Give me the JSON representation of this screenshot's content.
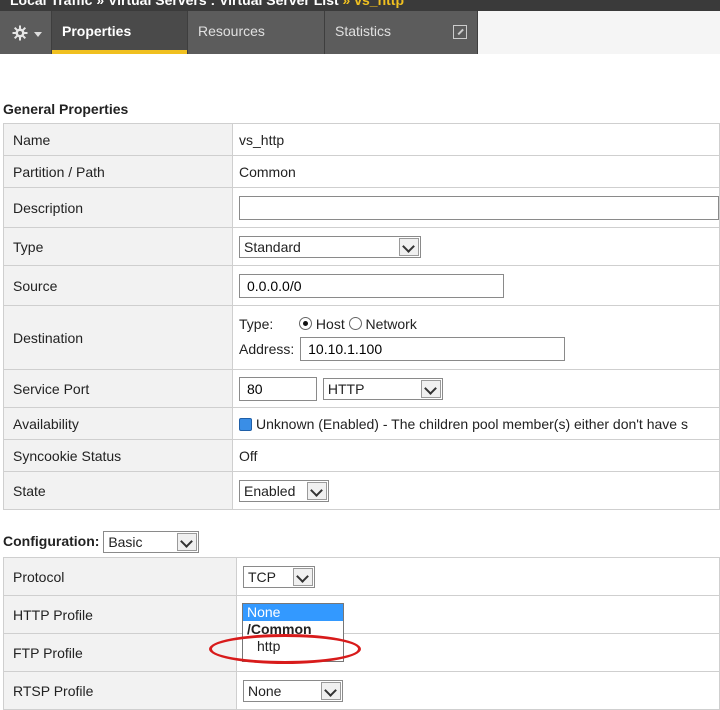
{
  "breadcrumb": {
    "part1": "Local Traffic",
    "sep": "»",
    "part2": "Virtual Servers : Virtual Server List",
    "current": "vs_http"
  },
  "tabs": [
    {
      "label": "Properties",
      "active": true
    },
    {
      "label": "Resources",
      "active": false
    },
    {
      "label": "Statistics",
      "active": false
    }
  ],
  "general": {
    "title": "General Properties",
    "name": {
      "label": "Name",
      "value": "vs_http"
    },
    "partition": {
      "label": "Partition / Path",
      "value": "Common"
    },
    "description": {
      "label": "Description",
      "value": ""
    },
    "type": {
      "label": "Type",
      "value": "Standard"
    },
    "source": {
      "label": "Source",
      "value": "0.0.0.0/0"
    },
    "destination": {
      "label": "Destination",
      "type_label": "Type:",
      "host_label": "Host",
      "network_label": "Network",
      "address_label": "Address:",
      "address": "10.10.1.100"
    },
    "service_port": {
      "label": "Service Port",
      "port": "80",
      "protocol": "HTTP"
    },
    "availability": {
      "label": "Availability",
      "value": "Unknown (Enabled) - The children pool member(s) either don't have s"
    },
    "syncookie": {
      "label": "Syncookie Status",
      "value": "Off"
    },
    "state": {
      "label": "State",
      "value": "Enabled"
    }
  },
  "configuration": {
    "title": "Configuration:",
    "mode": "Basic",
    "protocol": {
      "label": "Protocol",
      "value": "TCP"
    },
    "http_profile": {
      "label": "HTTP Profile"
    },
    "ftp_profile": {
      "label": "FTP Profile"
    },
    "rtsp_profile": {
      "label": "RTSP Profile",
      "value": "None"
    }
  },
  "dropdown_options": {
    "none": "None",
    "group": "/Common",
    "http": "http"
  },
  "colors": {
    "accent": "#f0c020",
    "highlight": "#3399ff",
    "annotation": "#d81b1b"
  }
}
